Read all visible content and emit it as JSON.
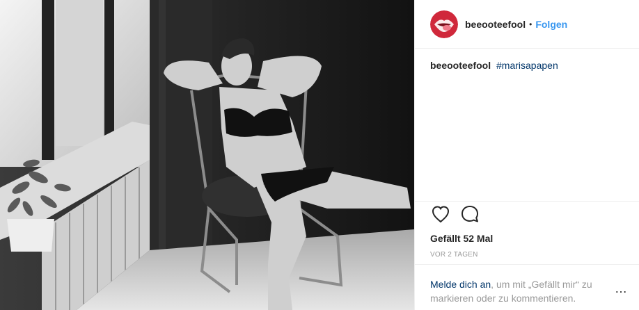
{
  "header": {
    "username": "beeooteefool",
    "separator": "•",
    "follow_label": "Folgen"
  },
  "caption": {
    "username": "beeooteefool",
    "hashtag": "#marisapapen"
  },
  "actions": {
    "like_icon": "heart-outline-icon",
    "comment_icon": "comment-bubble-icon"
  },
  "likes_text": "Gefällt 52 Mal",
  "timestamp": "VOR 2 TAGEN",
  "login_prompt": {
    "link": "Melde dich an",
    "rest": ", um mit „Gefällt mir“ zu markieren oder zu kommentieren."
  },
  "more_options": "…",
  "colors": {
    "link_blue": "#3897f0",
    "hashtag_navy": "#003569",
    "muted": "#999999",
    "text": "#262626",
    "avatar_red": "#d0283b"
  }
}
